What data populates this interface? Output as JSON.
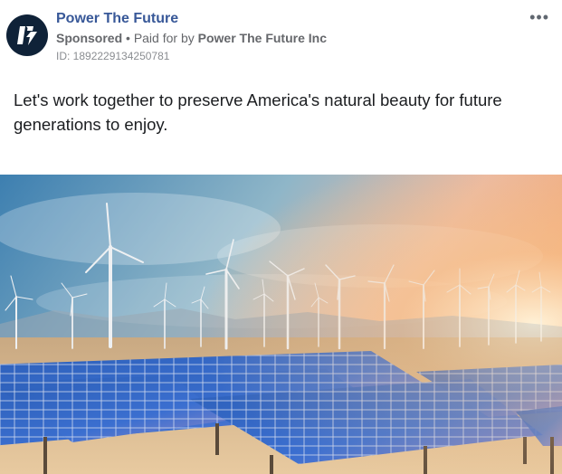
{
  "post": {
    "page_name": "Power The Future",
    "sponsored_label": "Sponsored",
    "separator": "•",
    "paid_for_prefix": "Paid for by",
    "paid_for_by": "Power The Future Inc",
    "ad_id": "ID: 1892229134250781",
    "more_icon": "ellipsis-icon",
    "text": "Let's work together to preserve America's natural beauty for future generations to enjoy."
  },
  "media": {
    "subject": "wind turbines and solar panels",
    "accent_color": "#385898",
    "avatar_bg": "#0f2238"
  }
}
